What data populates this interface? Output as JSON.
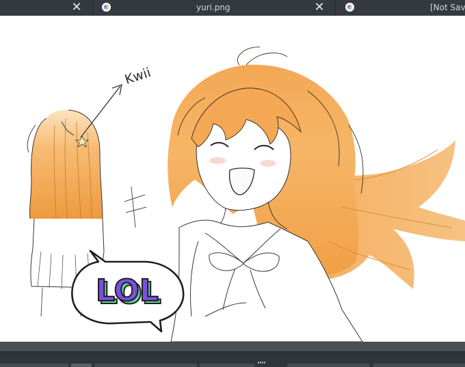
{
  "tabs": [
    {
      "label": "",
      "has_close": true
    },
    {
      "label": "yuri.png",
      "has_close": true
    },
    {
      "label": "[Not Save",
      "has_close": false
    }
  ],
  "canvas": {
    "annotation": "Kwii",
    "speech_bubble": "LOL"
  },
  "colors": {
    "hair": "#f0a24a",
    "hair_dark": "#e08a2c",
    "hair_light": "#fbd7a5",
    "bubble_text": "#7b4fe0",
    "bubble_shadow": "#5fd39b"
  }
}
